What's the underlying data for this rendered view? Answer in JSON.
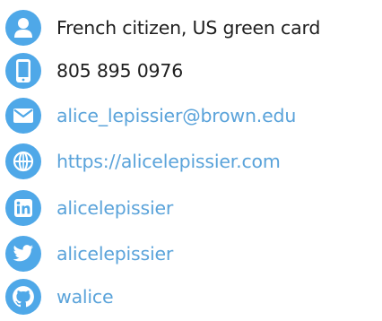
{
  "colors": {
    "icon_bg": "#4fa8e8",
    "icon_fg": "#ffffff",
    "text": "#1f1f1f",
    "link": "#5aa3da"
  },
  "contacts": [
    {
      "icon": "user-icon",
      "text": "French citizen, US green card",
      "kind": "plain"
    },
    {
      "icon": "phone-icon",
      "text": "805 895 0976",
      "kind": "plain"
    },
    {
      "icon": "email-icon",
      "text": "alice_lepissier@brown.edu",
      "kind": "link"
    },
    {
      "icon": "globe-icon",
      "text": "https://alicelepissier.com",
      "kind": "link"
    },
    {
      "icon": "linkedin-icon",
      "text": "alicelepissier",
      "kind": "link"
    },
    {
      "icon": "twitter-icon",
      "text": "alicelepissier",
      "kind": "link"
    },
    {
      "icon": "github-icon",
      "text": "walice",
      "kind": "link"
    }
  ]
}
